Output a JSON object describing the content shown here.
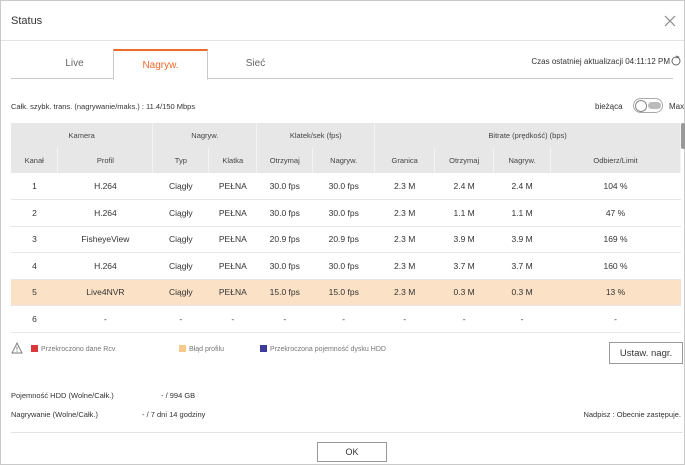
{
  "window": {
    "title": "Status"
  },
  "tabs": [
    {
      "label": "Live"
    },
    {
      "label": "Nagryw."
    },
    {
      "label": "Sieć"
    }
  ],
  "last_update": {
    "label": "Czas ostatniej aktualizacji 04:11:12 PM"
  },
  "total_bitrate": {
    "label": "Całk. szybk. trans. (nagrywanie/maks.) : 11.4/150 Mbps"
  },
  "mode_toggle": {
    "left_label": "bieżąca",
    "right_label": "Max",
    "state": "bieżąca"
  },
  "table": {
    "group_headers": [
      "Kamera",
      "Nagryw.",
      "Klatek/sek (fps)",
      "Bitrate (prędkość) (bps)"
    ],
    "columns": [
      "Kanał",
      "Profil",
      "Typ",
      "Klatka",
      "Otrzymaj",
      "Nagryw.",
      "Granica",
      "Otrzymaj",
      "Nagryw.",
      "Odbierz/Limit"
    ],
    "rows": [
      [
        "1",
        "H.264",
        "Ciągły",
        "PEŁNA",
        "30.0 fps",
        "30.0 fps",
        "2.3 M",
        "2.4 M",
        "2.4 M",
        "104 %"
      ],
      [
        "2",
        "H.264",
        "Ciągły",
        "PEŁNA",
        "30.0 fps",
        "30.0 fps",
        "2.3 M",
        "1.1 M",
        "1.1 M",
        "47 %"
      ],
      [
        "3",
        "FisheyeView",
        "Ciągły",
        "PEŁNA",
        "20.9 fps",
        "20.9 fps",
        "2.3 M",
        "3.9 M",
        "3.9 M",
        "169 %"
      ],
      [
        "4",
        "H.264",
        "Ciągły",
        "PEŁNA",
        "30.0 fps",
        "30.0 fps",
        "2.3 M",
        "3.7 M",
        "3.7 M",
        "160 %"
      ],
      [
        "5",
        "Live4NVR",
        "Ciągły",
        "PEŁNA",
        "15.0 fps",
        "15.0 fps",
        "2.3 M",
        "0.3 M",
        "0.3 M",
        "13 %"
      ],
      [
        "6",
        "-",
        "-",
        "-",
        "-",
        "-",
        "-",
        "-",
        "-",
        "-"
      ]
    ],
    "selected_row": "5"
  },
  "legend": [
    {
      "label": "Przekroczono dane Rcv",
      "color": "#d9363e"
    },
    {
      "label": "Błąd profilu",
      "color": "#f7c98a"
    },
    {
      "label": "Przekroczona pojemność dysku HDD",
      "color": "#3d3a9e"
    }
  ],
  "buttons": {
    "set_recording": "Ustaw. nagr.",
    "ok": "OK"
  },
  "hdd": {
    "label": "Pojemność HDD (Wolne/Całk.)",
    "value": "- / 994 GB"
  },
  "recording": {
    "label": "Nagrywanie (Wolne/Całk.)",
    "value": "- / 7 dni 14 godziny"
  },
  "overwrite": {
    "label": "Nadpisz : Obecnie zastępuje."
  },
  "colors": {
    "accent": "#ee6a2b",
    "selected_row": "#fbe1c5",
    "header_bg": "#e7e7e7"
  }
}
